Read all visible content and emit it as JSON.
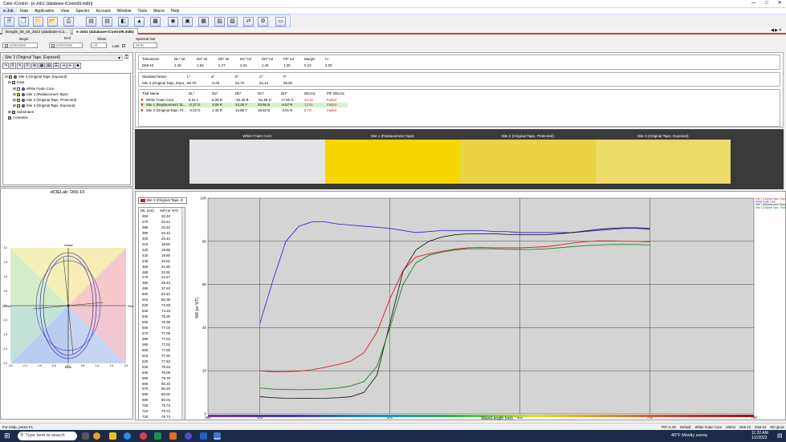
{
  "window": {
    "title": "Color iControl - [e-Job1 (database-iControl9.mdb)]"
  },
  "menu": [
    "e-Job",
    "Data",
    "Application",
    "View",
    "Spectro",
    "Account",
    "Window",
    "Tools",
    "Macro",
    "Help"
  ],
  "tabs": {
    "tab1": "Benglis_08_06_2022 (database-iCo...",
    "tab2": "e-Job1 (database-iControl9.mdb)"
  },
  "filters": {
    "begin_label": "Begin",
    "begin_value": "12/30/1899",
    "end_label": "End",
    "end_value": "12/30/1899",
    "show_label": "Show",
    "show_value": "All",
    "last_label": "Last",
    "spectral_label": "Spectral Set",
    "spectral_value": "SPIN"
  },
  "left_panel": {
    "selected": "Site 3 (Original Tape, Exposed)",
    "tree": [
      "Site 3 (Original Tape, Exposed)",
      "Data",
      "White Foam Core",
      "Site 1 (Replacement Tape)",
      "Site 2 (Original Tape, Protected)",
      "Site 3 (Original Tape, Exposed)",
      "Substrates",
      "Colorants"
    ]
  },
  "cielab": {
    "title": "dCIELab: D65-10",
    "top_label": "Yellow",
    "right_label": "Red",
    "left_label": "Green",
    "bottom_label": "Blue",
    "x_ticks": [
      "-3.2",
      "-2.4",
      "-1.6",
      "-0.8",
      "0.0",
      "0.8",
      "1.6",
      "2.4",
      "3.2"
    ],
    "y_ticks": [
      "3.2",
      "2.4",
      "1.6",
      "0.8",
      "0.0",
      "-0.8",
      "-1.6",
      "-2.4",
      "-3.2"
    ]
  },
  "tolerances": {
    "headers": [
      "Tolerances",
      "DL* tol",
      "Da* tol",
      "Db* tol",
      "DC* tol",
      "DH* tol",
      "P/F tol",
      "Margin",
      "l:c"
    ],
    "row": [
      "D65-10",
      "2.49",
      "1.53",
      "2.27",
      "2.34",
      "1.46",
      "1.00",
      "0.10",
      "2.00"
    ]
  },
  "standard": {
    "headers": [
      "Standard Name",
      "L*",
      "a*",
      "b*",
      "C*",
      "h*"
    ],
    "row": [
      "Site 3 (Original Tape, Expo...",
      "86.79",
      "-6.29",
      "52.75",
      "53.13",
      "96.80"
    ]
  },
  "trials": {
    "headers": [
      "Trial Name",
      "DL*",
      "Da*",
      "Db*",
      "DC*",
      "DH*",
      "DEcmc",
      "P/F DEcmc"
    ],
    "rows": [
      [
        "White Foam Core",
        "6.51 L",
        "6.39 R",
        "-54.28 B",
        "-51.69 D",
        "17.55 G",
        "22.41",
        "Failed"
      ],
      [
        "Site 1 (Replacement Ta...",
        "-0.37 D",
        "3.09 R",
        "34.26 Y",
        "33.95 B",
        "-5.57 R",
        "13.51",
        "Failed"
      ],
      [
        "Site 2 (Original Tape, Pr...",
        "-2.42 D",
        "2.49 R",
        "16.89 Y",
        "16.62 B",
        "-3.91 R",
        "8.79",
        "Failed"
      ]
    ]
  },
  "swatches": [
    {
      "label": "White Foam Core",
      "color": "#e4e4e6"
    },
    {
      "label": "Site 1 (Replacement Tape)",
      "color": "#f5d600"
    },
    {
      "label": "Site 2 (Original Tape, Protected)",
      "color": "#ead445"
    },
    {
      "label": "Site 3 (Original Tape, Exposed)",
      "color": "#eadb6a"
    }
  ],
  "wl_list": {
    "selected": "Site 3 (Original Tape, E",
    "col1": "WL (nm)",
    "col2": "%R (or %T)",
    "rows": [
      [
        "360",
        "20.42"
      ],
      [
        "370",
        "20.42"
      ],
      [
        "380",
        "20.42"
      ],
      [
        "390",
        "20.42"
      ],
      [
        "400",
        "20.42"
      ],
      [
        "410",
        "19.50"
      ],
      [
        "420",
        "19.65"
      ],
      [
        "430",
        "19.80"
      ],
      [
        "440",
        "20.51"
      ],
      [
        "450",
        "21.60"
      ],
      [
        "460",
        "22.91"
      ],
      [
        "470",
        "24.47"
      ],
      [
        "480",
        "28.43"
      ],
      [
        "490",
        "37.93"
      ],
      [
        "500",
        "53.43"
      ],
      [
        "510",
        "66.35"
      ],
      [
        "520",
        "72.69"
      ],
      [
        "530",
        "74.18"
      ],
      [
        "540",
        "75.25"
      ],
      [
        "550",
        "76.39"
      ],
      [
        "560",
        "77.03"
      ],
      [
        "570",
        "77.08"
      ],
      [
        "580",
        "77.04"
      ],
      [
        "590",
        "77.03"
      ],
      [
        "600",
        "77.00"
      ],
      [
        "610",
        "77.20"
      ],
      [
        "620",
        "77.53"
      ],
      [
        "630",
        "78.33"
      ],
      [
        "640",
        "79.09"
      ],
      [
        "650",
        "79.79"
      ],
      [
        "660",
        "80.20"
      ],
      [
        "670",
        "80.20"
      ],
      [
        "680",
        "80.00"
      ],
      [
        "690",
        "80.04"
      ],
      [
        "700",
        "79.73"
      ],
      [
        "710",
        "79.73"
      ],
      [
        "720",
        "79.73"
      ]
    ]
  },
  "chart_data": {
    "type": "line",
    "xlabel": "WaveLength (nm)",
    "ylabel": "%R (or %T)",
    "xlim": [
      360,
      780
    ],
    "ylim": [
      0,
      100
    ],
    "x_ticks": [
      "360",
      "400",
      "500",
      "600",
      "700",
      "780"
    ],
    "y_ticks": [
      "0",
      "20",
      "40",
      "60",
      "80",
      "100"
    ],
    "legend_position": "top-right",
    "series": [
      {
        "name": "Site 3 (Original Tape, Expo",
        "color": "#d02020",
        "x": [
          400,
          410,
          420,
          430,
          440,
          450,
          460,
          470,
          480,
          490,
          500,
          510,
          520,
          530,
          540,
          550,
          560,
          570,
          580,
          590,
          600,
          610,
          620,
          630,
          640,
          650,
          660,
          670,
          680,
          690,
          700
        ],
        "y": [
          20,
          19.5,
          19.6,
          19.8,
          20.5,
          21.6,
          22.9,
          24.5,
          28.4,
          37.9,
          53.4,
          66.4,
          72.7,
          74.2,
          75.3,
          76.4,
          77,
          77.1,
          77,
          77,
          77,
          77.2,
          77.5,
          78.3,
          79.1,
          79.8,
          80.2,
          80.2,
          80,
          80,
          79.7
        ]
      },
      {
        "name": "White Foam Core",
        "color": "#3030d0",
        "x": [
          400,
          410,
          420,
          430,
          440,
          450,
          460,
          470,
          480,
          490,
          500,
          510,
          520,
          530,
          540,
          550,
          560,
          570,
          580,
          590,
          600,
          610,
          620,
          630,
          640,
          650,
          660,
          670,
          680,
          690,
          700
        ],
        "y": [
          42,
          62,
          80,
          87,
          89,
          89,
          88,
          87.5,
          87,
          86.5,
          86,
          85,
          84,
          84.5,
          85,
          85,
          85,
          85,
          84.5,
          84.5,
          84,
          84,
          84,
          84,
          84,
          84.5,
          85,
          85.5,
          86,
          86,
          85.5
        ]
      },
      {
        "name": "Site 1 (Replacement Tape)",
        "color": "#202020",
        "x": [
          400,
          410,
          420,
          430,
          440,
          450,
          460,
          470,
          480,
          490,
          500,
          510,
          520,
          530,
          540,
          550,
          560,
          570,
          580,
          590,
          600,
          610,
          620,
          630,
          640,
          650,
          660,
          670,
          680,
          690,
          700
        ],
        "y": [
          8,
          7.5,
          7.3,
          7.2,
          7.2,
          7.3,
          7.5,
          8,
          10,
          18,
          42,
          66,
          76,
          80,
          82,
          83,
          83.5,
          83.5,
          83.5,
          83.2,
          83,
          83,
          83,
          83.5,
          84,
          84.8,
          85.5,
          86,
          86.3,
          86.3,
          86
        ]
      },
      {
        "name": "Site 2 (Original Tape, Prote",
        "color": "#208020",
        "x": [
          400,
          410,
          420,
          430,
          440,
          450,
          460,
          470,
          480,
          490,
          500,
          510,
          520,
          530,
          540,
          550,
          560,
          570,
          580,
          590,
          600,
          610,
          620,
          630,
          640,
          650,
          660,
          670,
          680,
          690,
          700
        ],
        "y": [
          12,
          11.5,
          11.3,
          11.2,
          11.3,
          11.5,
          12,
          13,
          15,
          22,
          40,
          60,
          70,
          73.5,
          75,
          76,
          76.5,
          76.5,
          76.5,
          76.3,
          76.2,
          76.3,
          76.5,
          77,
          77.5,
          78,
          78.3,
          78.5,
          78.5,
          78.5,
          78.3
        ]
      }
    ]
  },
  "status": {
    "left": "For Help, press F1",
    "right_items": [
      "-P/F+1.00",
      "Default",
      "White Foam Core",
      "0/5/24",
      "D65-10",
      "D65-10",
      "NO gloss"
    ]
  },
  "taskbar": {
    "search": "Type here to search",
    "weather": "40°F  Mostly sunny",
    "time": "11:32 AM",
    "date": "1/2/2023"
  }
}
